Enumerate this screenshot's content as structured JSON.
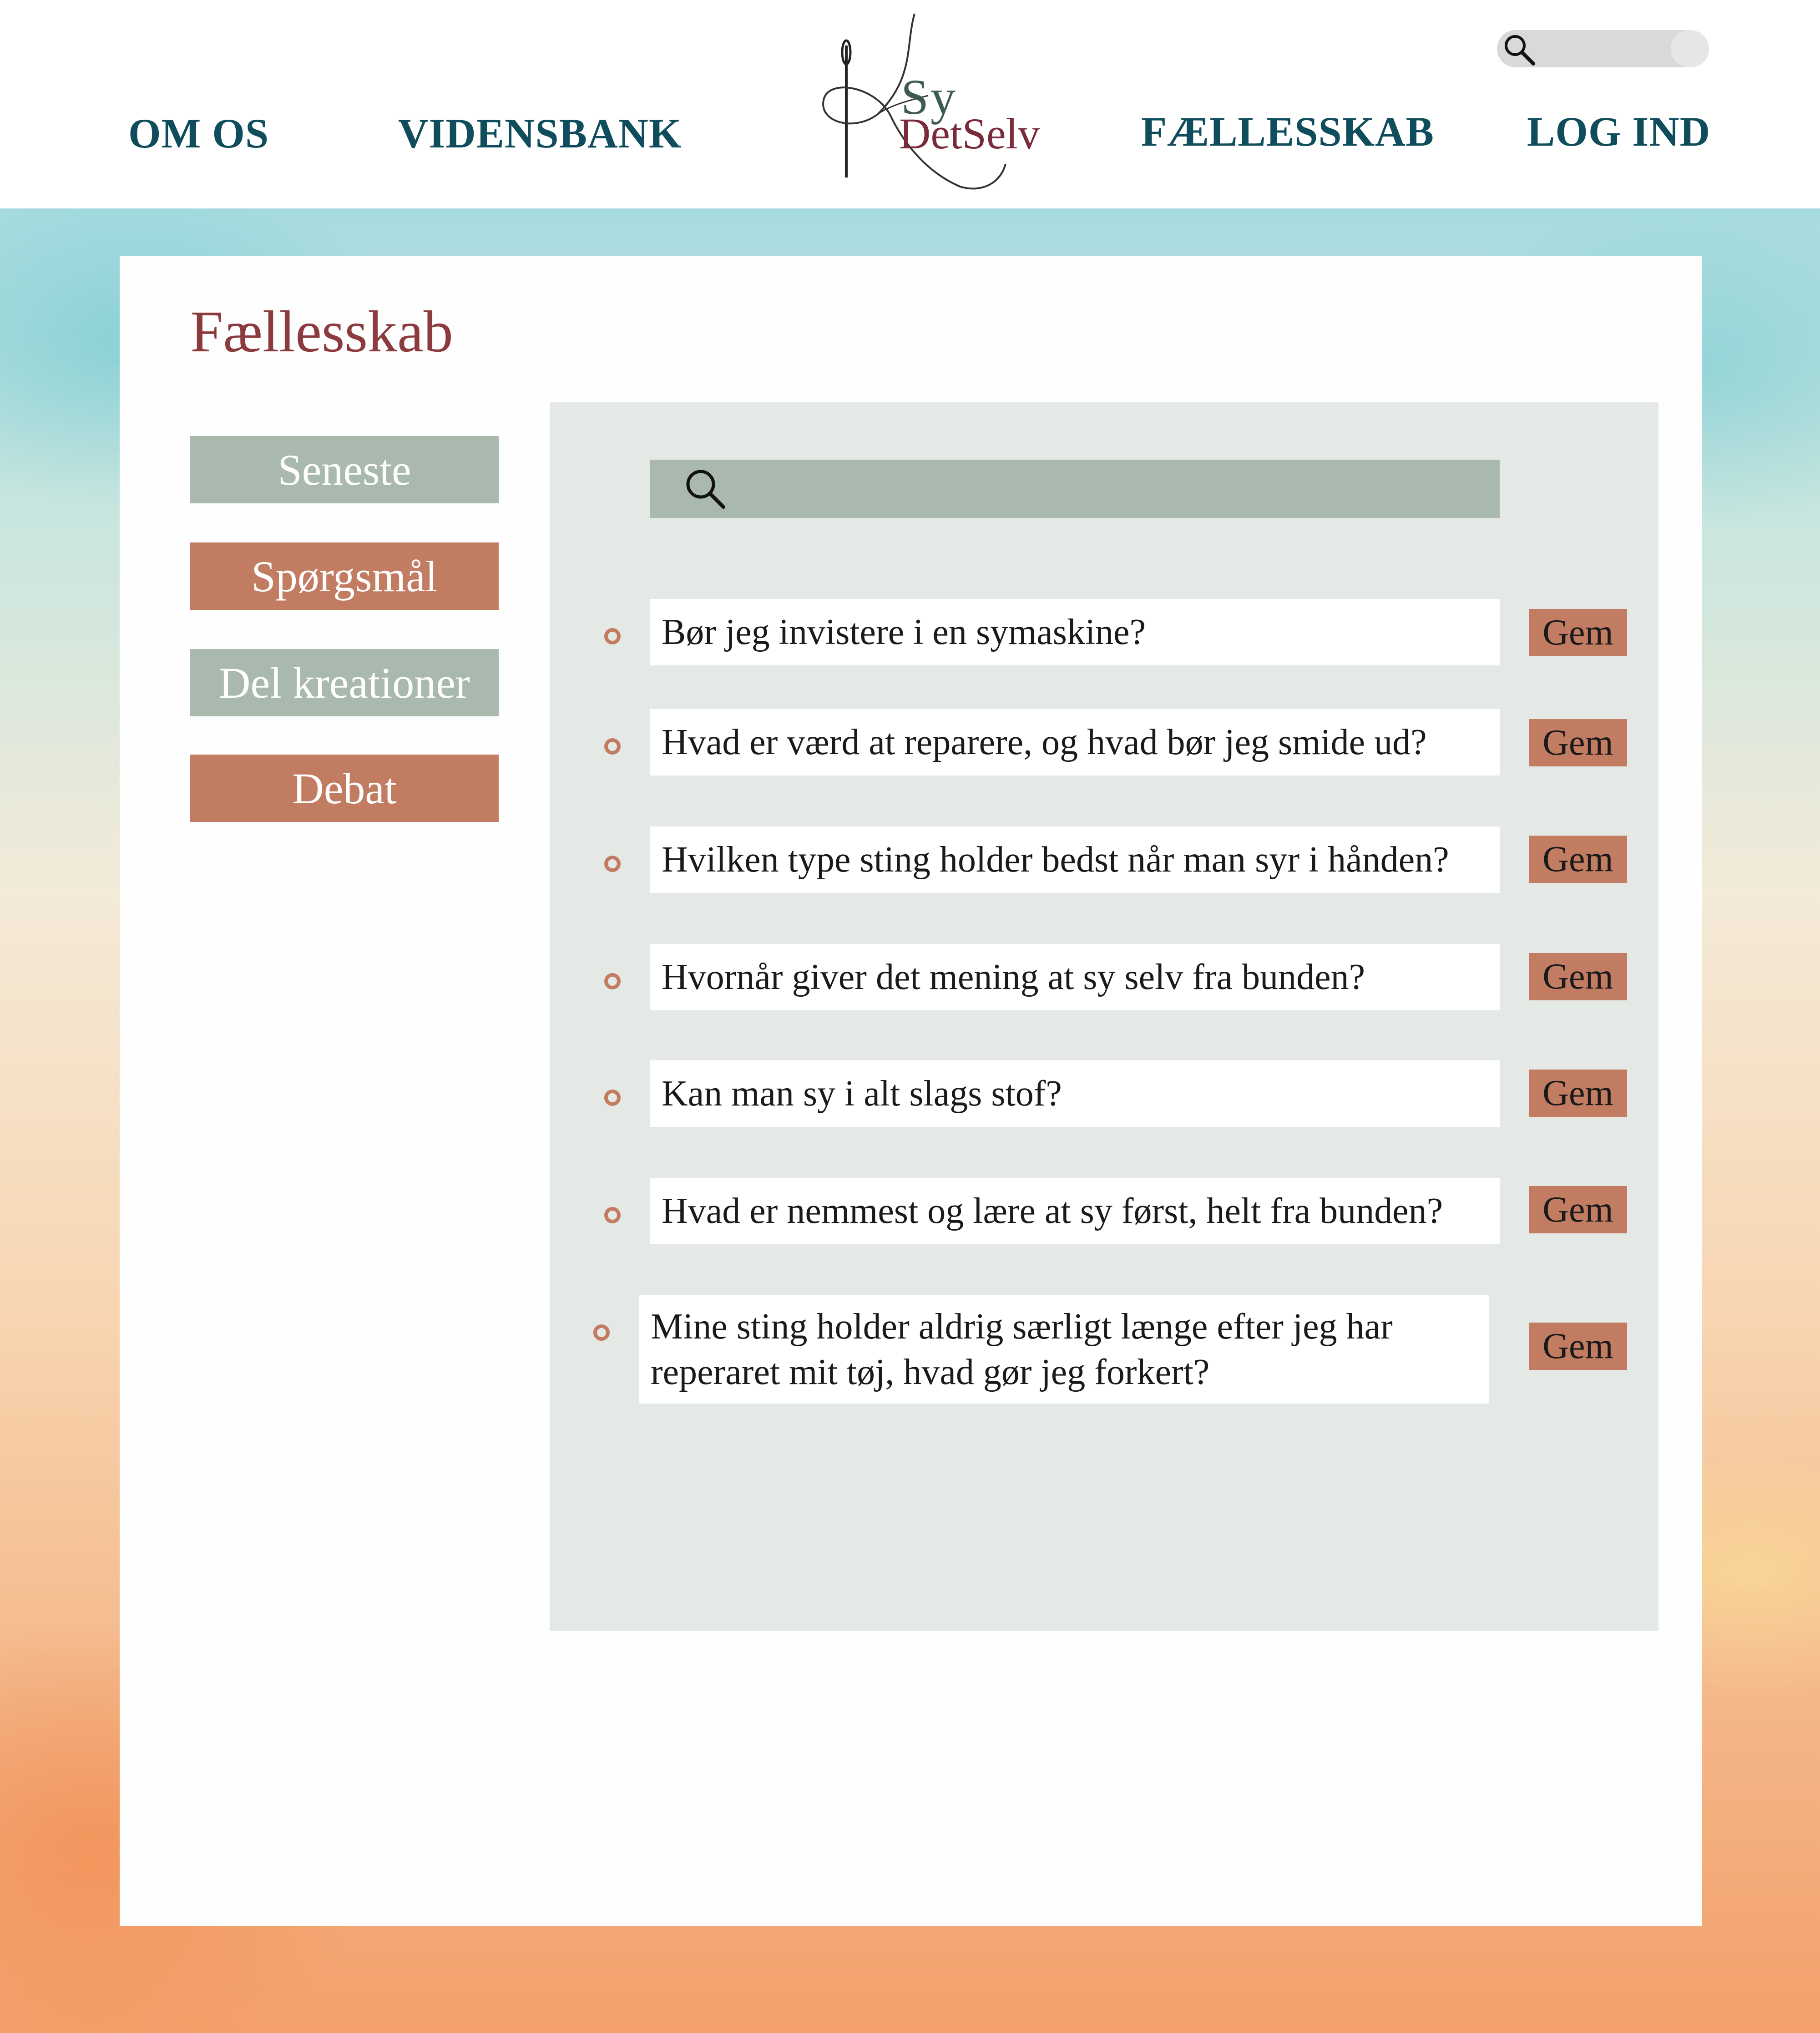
{
  "nav": {
    "left": [
      "OM OS",
      "VIDENSBANK"
    ],
    "right": [
      "FÆLLESSKAB",
      "LOG IND"
    ]
  },
  "logo": {
    "line1": "Sy",
    "line2": "DetSelv"
  },
  "page": {
    "title": "Fællesskab"
  },
  "sidebar": {
    "items": [
      {
        "label": "Seneste",
        "color": "#a9b9ad"
      },
      {
        "label": "Spørgsmål",
        "color": "#c27c62"
      },
      {
        "label": "Del kreationer",
        "color": "#a9b9ad"
      },
      {
        "label": "Debat",
        "color": "#c27c62"
      }
    ]
  },
  "questions": [
    {
      "text": "Bør jeg invistere i en symaskine?",
      "save": "Gem"
    },
    {
      "text": "Hvad er værd at reparere, og hvad bør jeg smide ud?",
      "save": "Gem"
    },
    {
      "text": "Hvilken type sting holder bedst når man syr i hånden?",
      "save": "Gem"
    },
    {
      "text": "Hvornår giver det mening at sy selv fra bunden?",
      "save": "Gem"
    },
    {
      "text": "Kan man sy i alt slags stof?",
      "save": "Gem"
    },
    {
      "text": "Hvad er nemmest og lære at sy først, helt fra bunden?",
      "save": "Gem"
    },
    {
      "text": "Mine sting holder aldrig særligt længe efter jeg har reperaret mit tøj, hvad gør jeg forkert?",
      "save": "Gem"
    }
  ],
  "icons": {
    "top_search": "search-icon",
    "panel_search": "search-icon"
  },
  "colors": {
    "nav": "#0f4c5c",
    "title": "#8b3a3e",
    "accent_rust": "#c27c62",
    "accent_green": "#a9b9ad",
    "panel": "#e5e9e6"
  }
}
